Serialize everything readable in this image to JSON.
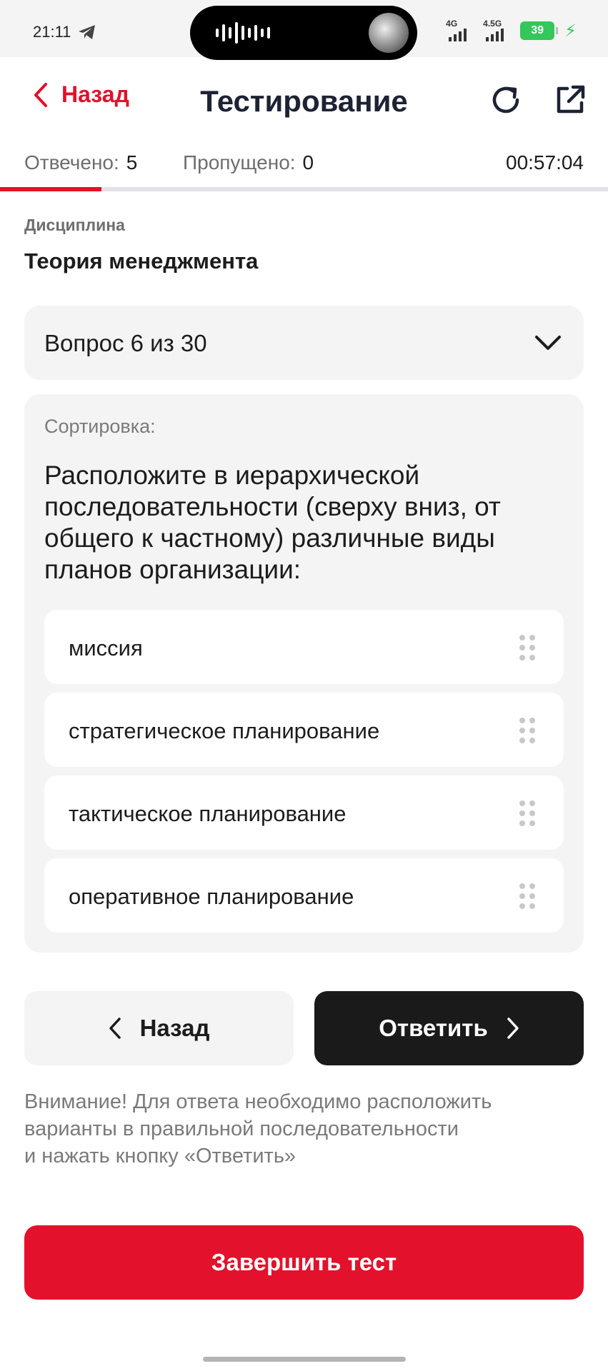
{
  "status_bar": {
    "time": "21:11",
    "signal1_label": "4G",
    "signal2_label": "4.5G",
    "battery": "39",
    "icons": [
      "telegram-icon",
      "audio-wave-icon",
      "signal-icon",
      "charging-bolt-icon"
    ]
  },
  "header": {
    "back_label": "Назад",
    "title": "Тестирование",
    "icons": [
      "chevron-left-icon",
      "refresh-icon",
      "external-link-icon"
    ]
  },
  "stats": {
    "answered_label": "Отвечено:",
    "answered_value": "5",
    "skipped_label": "Пропущено:",
    "skipped_value": "0",
    "timer": "00:57:04",
    "progress_fraction": 0.1667
  },
  "discipline": {
    "label": "Дисциплина",
    "value": "Теория менеджмента"
  },
  "question_selector": {
    "selected": "Вопрос 6 из 30"
  },
  "question": {
    "type": "Сортировка:",
    "text": "Расположите в иерархической последовательности (сверху вниз, от общего к частному) различные виды планов организации:",
    "options": [
      "миссия",
      "стратегическое планирование",
      "тактическое планирование",
      "оперативное планирование"
    ]
  },
  "buttons": {
    "back": "Назад",
    "answer": "Ответить",
    "finish": "Завершить тест"
  },
  "notice": "Внимание! Для ответа необходимо расположить\nварианты в правильной последовательности\nи нажать кнопку «Ответить»",
  "colors": {
    "accent": "#e3112b",
    "dark_button": "#1a1a1a",
    "card_bg": "#f4f4f4",
    "battery": "#34c759"
  }
}
